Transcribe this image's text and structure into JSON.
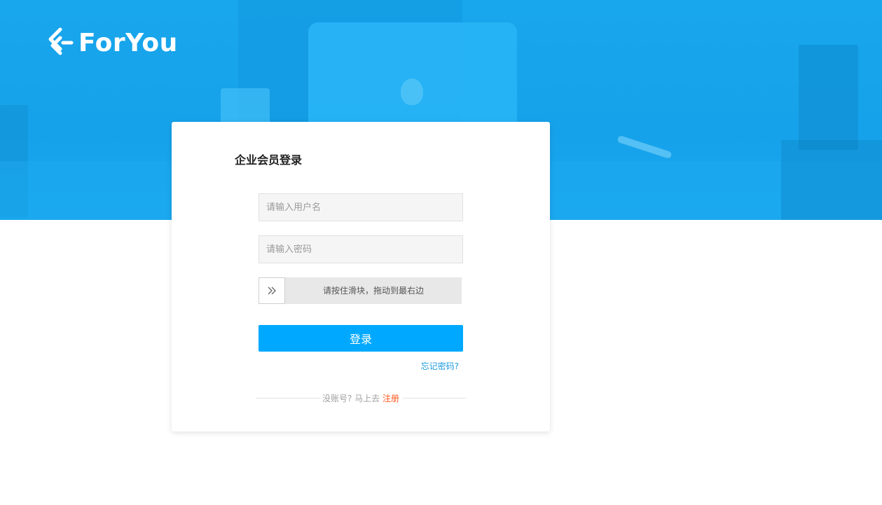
{
  "brand": {
    "logo_text": "ForYou",
    "logo_icon": "foryou-logo-icon"
  },
  "login": {
    "title": "企业会员登录",
    "username_placeholder": "请输入用户名",
    "password_placeholder": "请输入密码",
    "slider_text": "请按住滑块，拖动到最右边",
    "slider_icon": "double-chevron-right-icon",
    "submit_label": "登录",
    "forgot_label": "忘记密码?",
    "no_account_text": "没账号? 马上去",
    "register_label": "注册"
  },
  "colors": {
    "hero_bg": "#18a6ec",
    "primary": "#00a9ff",
    "link": "#1d9be0",
    "register_link": "#ff5a1f"
  }
}
